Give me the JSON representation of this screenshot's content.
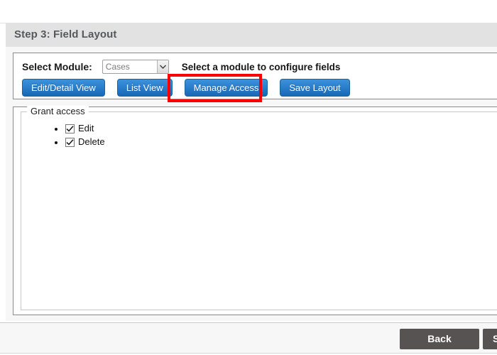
{
  "header": {
    "title": "Step 3: Field Layout"
  },
  "module_row": {
    "label": "Select Module:",
    "selected_module": "Cases",
    "options": [
      "Cases"
    ],
    "hint": "Select a module to configure fields",
    "dropdown_icon": "chevron-down-icon"
  },
  "toolbar": {
    "edit_detail_view": "Edit/Detail View",
    "list_view": "List View",
    "manage_access": "Manage Access",
    "save_layout": "Save Layout"
  },
  "annotation": {
    "highlight_color": "#fa0005",
    "target": "Manage Access"
  },
  "grant_access": {
    "legend": "Grant access",
    "items": [
      {
        "label": "Edit",
        "checked": true
      },
      {
        "label": "Delete",
        "checked": true
      }
    ]
  },
  "footer": {
    "back_label": "Back",
    "next_label": "S"
  },
  "colors": {
    "button_blue_top": "#3d92dc",
    "button_blue_bottom": "#1769b5",
    "footer_button": "#575352",
    "header_bar": "#e2e2e2",
    "body_bg": "#f7f7f7"
  }
}
